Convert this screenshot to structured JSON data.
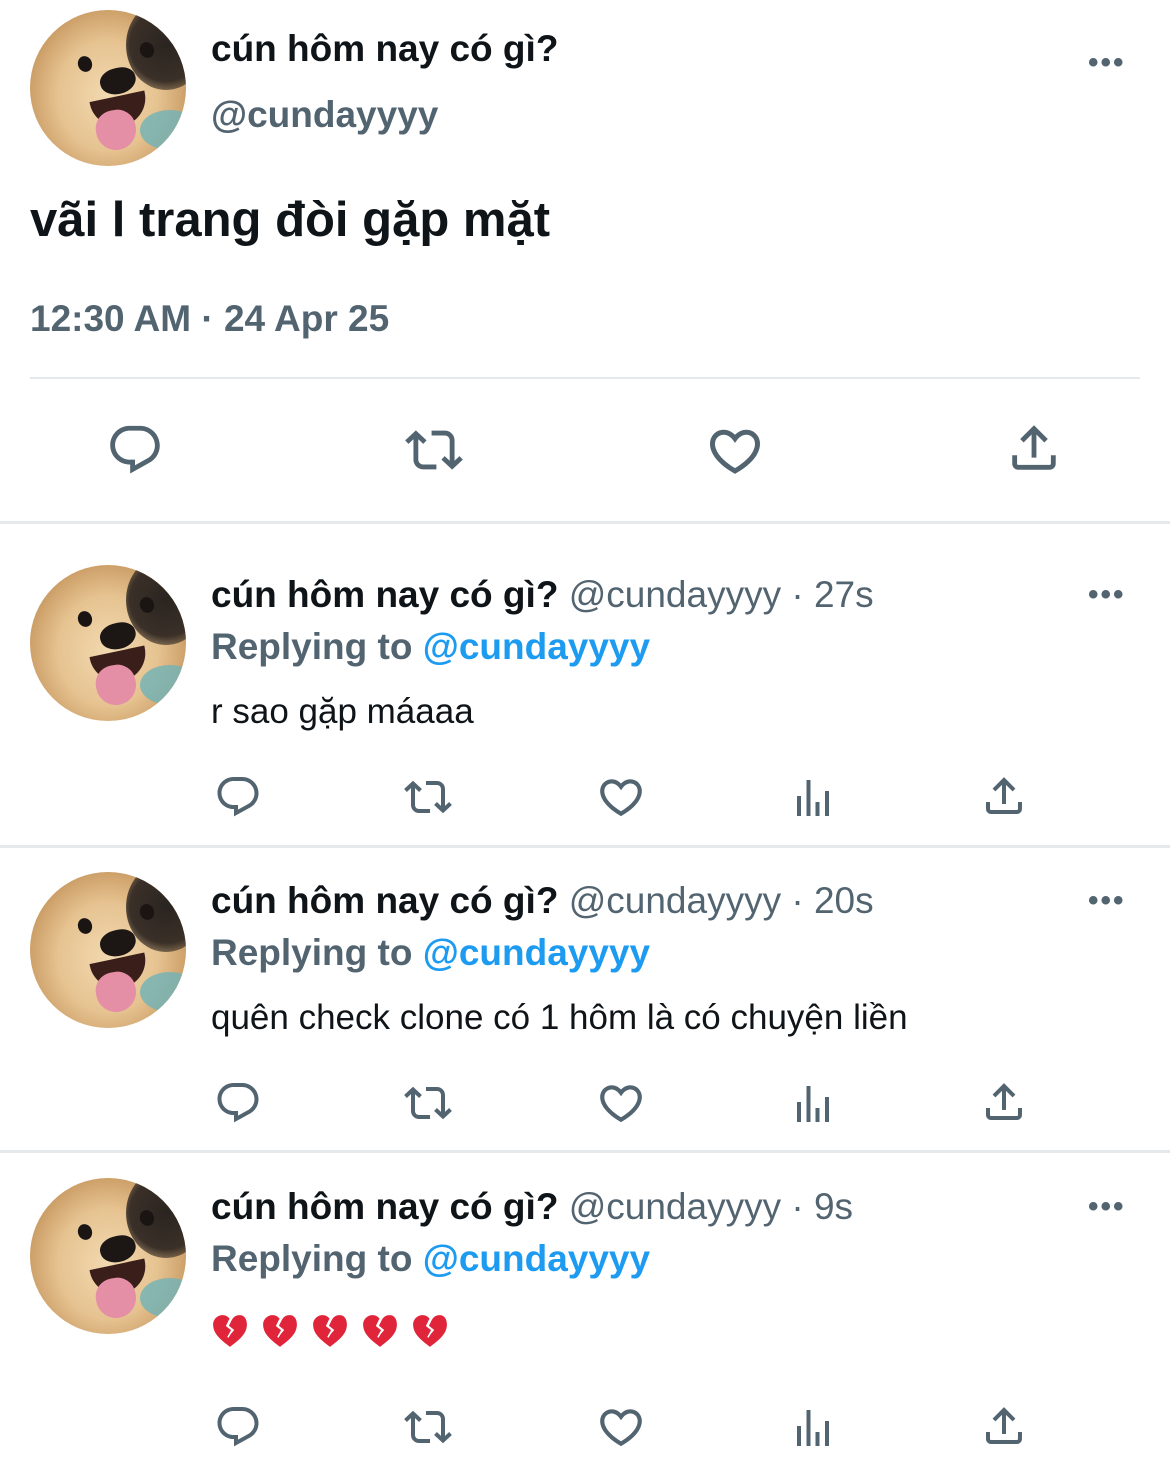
{
  "main_tweet": {
    "display_name": "cún hôm nay có gì?",
    "handle": "@cundayyyy",
    "text": "vãi l trang đòi gặp mặt",
    "timestamp": "12:30 AM · 24 Apr 25",
    "more_label": "•••",
    "actions": [
      "reply-icon",
      "retweet-icon",
      "like-icon",
      "share-icon"
    ]
  },
  "replies": [
    {
      "display_name": "cún hôm nay có gì?",
      "handle": "@cundayyyy",
      "separator": "·",
      "time": "27s",
      "replying_label": "Replying to",
      "replying_to": "@cundayyyy",
      "text": "r sao gặp máaaa",
      "more_label": "•••"
    },
    {
      "display_name": "cún hôm nay có gì?",
      "handle": "@cundayyyy",
      "separator": "·",
      "time": "20s",
      "replying_label": "Replying to",
      "replying_to": "@cundayyyy",
      "text": "quên check clone có 1 hôm là có chuyện liền",
      "more_label": "•••"
    },
    {
      "display_name": "cún hôm nay có gì?",
      "handle": "@cundayyyy",
      "separator": "·",
      "time": "9s",
      "replying_label": "Replying to",
      "replying_to": "@cundayyyy",
      "emojis": [
        "broken-heart-icon",
        "broken-heart-icon",
        "broken-heart-icon",
        "broken-heart-icon",
        "broken-heart-icon"
      ],
      "more_label": "•••"
    }
  ],
  "colors": {
    "text_primary": "#0f1419",
    "text_secondary": "#536471",
    "link": "#1d9bf0",
    "divider": "#e6e9eb",
    "broken_heart": "#e0243a"
  }
}
